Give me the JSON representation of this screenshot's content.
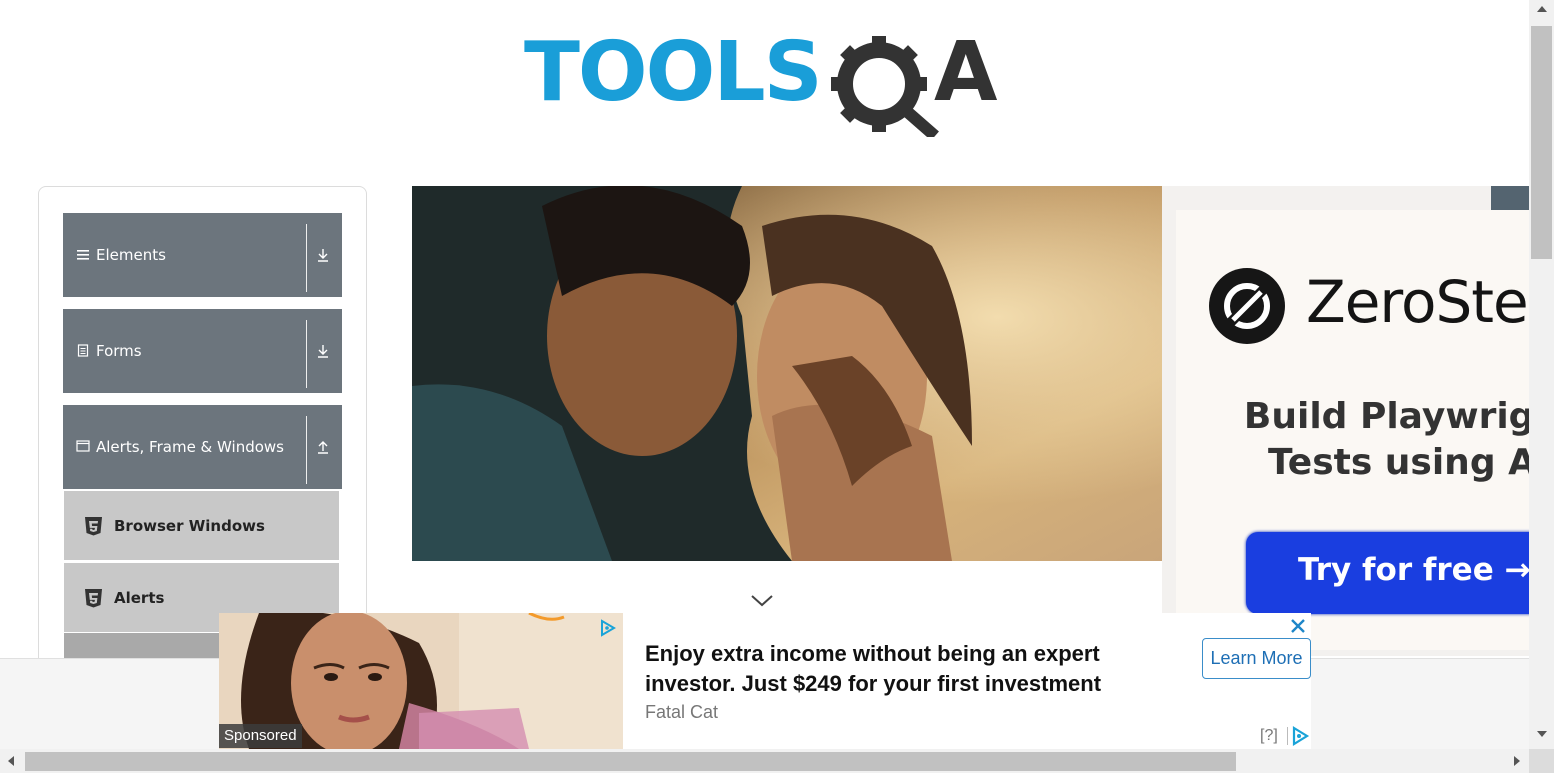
{
  "logo": {
    "text_left": "TOOLS",
    "text_right": "QA",
    "brand_blue": "#1a9ed8",
    "brand_dark": "#333333"
  },
  "sidebar": {
    "groups": [
      {
        "label": "Elements",
        "icon": "hamburger-icon",
        "toggle": "download-arrow-icon"
      },
      {
        "label": "Forms",
        "icon": "document-icon",
        "toggle": "download-arrow-icon"
      },
      {
        "label": "Alerts, Frame & Windows",
        "icon": "window-icon",
        "toggle": "upload-arrow-icon"
      }
    ],
    "items": [
      {
        "label": "Browser Windows",
        "icon": "html5-icon"
      },
      {
        "label": "Alerts",
        "icon": "html5-icon"
      }
    ],
    "header_color": "#6c757d",
    "item_color": "#c8c8c8"
  },
  "right_ad": {
    "brand": "ZeroSte",
    "tagline_line1": "Build Playwrigh",
    "tagline_line2": "Tests using A",
    "cta": "Try for free →",
    "cta_color": "#1a3ee0"
  },
  "bottom_ad": {
    "sponsored": "Sponsored",
    "headline": "Enjoy extra income without being an expert investor. Just $249 for your first investment",
    "source": "Fatal Cat",
    "cta": "Learn More",
    "help": "[?]"
  }
}
